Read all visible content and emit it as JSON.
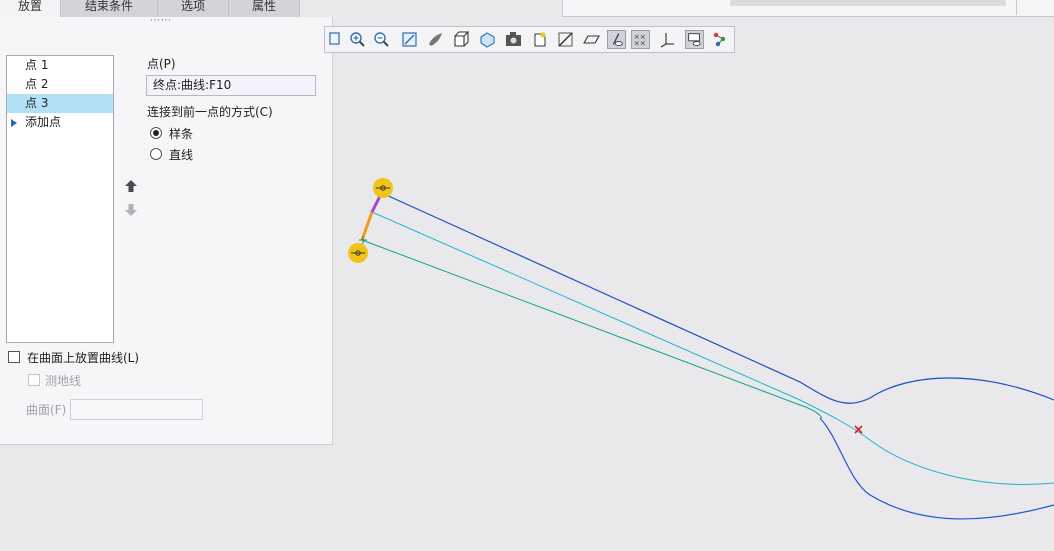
{
  "tabs": [
    {
      "label": "放置"
    },
    {
      "label": "结束条件"
    },
    {
      "label": "选项"
    },
    {
      "label": "属性"
    }
  ],
  "panel": {
    "grip": "⋯⋯",
    "points": [
      {
        "label": "点 1"
      },
      {
        "label": "点 2"
      },
      {
        "label": "点 3"
      }
    ],
    "add_point": "添加点",
    "point_label": "点(P)",
    "point_value": "终点:曲线:F10",
    "connect_label": "连接到前一点的方式(C)",
    "option_spline": "样条",
    "option_line": "直线",
    "place_on_surface": "在曲面上放置曲线(L)",
    "geodesic": "测地线",
    "surface_label": "曲面(F)",
    "surface_value": ""
  },
  "toolbar": {
    "icons": [
      "zoom-box-icon",
      "zoom-in-icon",
      "zoom-out-icon",
      "refit-icon",
      "shading-icon",
      "box-view-icon",
      "saved-views-icon",
      "camera-icon",
      "spin-center-icon",
      "plane-display-icon",
      "plane-tag-icon",
      "axis-display-icon",
      "point-display-icon",
      "csys-display-icon",
      "annotation-display-icon",
      "model-tree-icon"
    ]
  },
  "colors": {
    "curve_upper": "#1a4fc2",
    "curve_middle": "#1fb5cf",
    "curve_lower": "#14a388",
    "spoon": "#1f55d0",
    "handle": "#f0c419",
    "end_segment": "#f29a1e",
    "selected_row": "#b2e0f7"
  }
}
